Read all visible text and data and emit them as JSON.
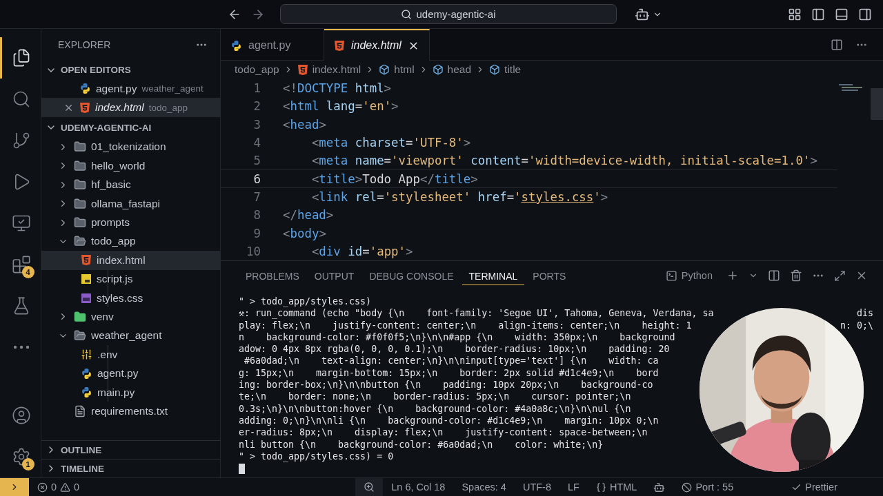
{
  "title_bar": {
    "search": "udemy-agentic-ai"
  },
  "activity_bar": [
    {
      "kind": "explorer",
      "selected": true
    },
    {
      "kind": "search",
      "selected": false
    },
    {
      "kind": "source-control",
      "selected": false
    },
    {
      "kind": "run",
      "selected": false
    },
    {
      "kind": "remote",
      "selected": false
    },
    {
      "kind": "extensions",
      "selected": false,
      "badge": "4"
    },
    {
      "kind": "testing",
      "selected": false
    },
    {
      "kind": "more",
      "selected": false
    }
  ],
  "activity_bottom": [
    {
      "kind": "account"
    },
    {
      "kind": "settings",
      "badge": "1"
    }
  ],
  "sidebar": {
    "title": "EXPLORER",
    "open_editors": {
      "label": "OPEN EDITORS",
      "expanded": true,
      "items": [
        {
          "name": "agent.py",
          "folder": "weather_agent",
          "kind": "python",
          "selected": false
        },
        {
          "name": "index.html",
          "folder": "todo_app",
          "kind": "html",
          "selected": true
        }
      ]
    },
    "workspace": {
      "label": "UDEMY-AGENTIC-AI",
      "expanded": true,
      "items": [
        {
          "name": "01_tokenization",
          "kind": "folder",
          "expanded": false,
          "selected": false
        },
        {
          "name": "hello_world",
          "kind": "folder",
          "expanded": false,
          "selected": false
        },
        {
          "name": "hf_basic",
          "kind": "folder",
          "expanded": false,
          "selected": false
        },
        {
          "name": "ollama_fastapi",
          "kind": "folder",
          "expanded": false,
          "selected": false
        },
        {
          "name": "prompts",
          "kind": "folder",
          "expanded": false,
          "selected": false
        },
        {
          "name": "todo_app",
          "kind": "folder",
          "expanded": true,
          "selected": false,
          "children": [
            {
              "name": "index.html",
              "kind": "html",
              "selected": true
            },
            {
              "name": "script.js",
              "kind": "js",
              "selected": false
            },
            {
              "name": "styles.css",
              "kind": "css",
              "selected": false
            }
          ]
        },
        {
          "name": "venv",
          "kind": "venv",
          "expanded": false,
          "selected": false
        },
        {
          "name": "weather_agent",
          "kind": "folder",
          "expanded": true,
          "selected": false,
          "children": [
            {
              "name": ".env",
              "kind": "env",
              "selected": false
            },
            {
              "name": "agent.py",
              "kind": "python",
              "selected": false
            },
            {
              "name": "main.py",
              "kind": "python",
              "selected": false
            }
          ]
        },
        {
          "name": "requirements.txt",
          "kind": "text",
          "selected": false
        }
      ]
    },
    "sections": [
      {
        "label": "OUTLINE",
        "expanded": false
      },
      {
        "label": "TIMELINE",
        "expanded": false
      }
    ]
  },
  "tabs": [
    {
      "name": "agent.py",
      "kind": "python",
      "selected": false
    },
    {
      "name": "index.html",
      "kind": "html",
      "selected": true
    }
  ],
  "breadcrumb": [
    {
      "label": "todo_app",
      "kind": "folder"
    },
    {
      "label": "index.html",
      "kind": "html"
    },
    {
      "label": "html",
      "kind": "element"
    },
    {
      "label": "head",
      "kind": "element"
    },
    {
      "label": "title",
      "kind": "element"
    }
  ],
  "code": [
    {
      "number": "1",
      "current": false,
      "tokens": [
        {
          "kind": "punct",
          "text": "<!"
        },
        {
          "kind": "tag",
          "text": "DOCTYPE"
        },
        {
          "kind": "attr",
          "text": " html"
        },
        {
          "kind": "punct",
          "text": ">"
        }
      ]
    },
    {
      "number": "2",
      "current": false,
      "tokens": [
        {
          "kind": "punct",
          "text": "<"
        },
        {
          "kind": "tag",
          "text": "html"
        },
        {
          "kind": "attr",
          "text": " lang"
        },
        {
          "kind": "plain",
          "text": "="
        },
        {
          "kind": "str",
          "text": "'en'"
        },
        {
          "kind": "punct",
          "text": ">"
        }
      ]
    },
    {
      "number": "3",
      "current": false,
      "tokens": [
        {
          "kind": "punct",
          "text": "<"
        },
        {
          "kind": "tag",
          "text": "head"
        },
        {
          "kind": "punct",
          "text": ">"
        }
      ]
    },
    {
      "number": "4",
      "current": false,
      "tokens": [
        {
          "kind": "punct",
          "text": "    <"
        },
        {
          "kind": "tag",
          "text": "meta"
        },
        {
          "kind": "attr",
          "text": " charset"
        },
        {
          "kind": "plain",
          "text": "="
        },
        {
          "kind": "str",
          "text": "'UTF-8'"
        },
        {
          "kind": "punct",
          "text": ">"
        }
      ]
    },
    {
      "number": "5",
      "current": false,
      "tokens": [
        {
          "kind": "punct",
          "text": "    <"
        },
        {
          "kind": "tag",
          "text": "meta"
        },
        {
          "kind": "attr",
          "text": " name"
        },
        {
          "kind": "plain",
          "text": "="
        },
        {
          "kind": "str",
          "text": "'viewport'"
        },
        {
          "kind": "attr",
          "text": " content"
        },
        {
          "kind": "plain",
          "text": "="
        },
        {
          "kind": "str",
          "text": "'width=device-width, initial-scale=1.0'"
        },
        {
          "kind": "punct",
          "text": ">"
        }
      ]
    },
    {
      "number": "6",
      "current": true,
      "tokens": [
        {
          "kind": "punct",
          "text": "    <"
        },
        {
          "kind": "tag",
          "text": "title"
        },
        {
          "kind": "punct",
          "text": ">"
        },
        {
          "kind": "plain",
          "text": "Todo App"
        },
        {
          "kind": "punct",
          "text": "</"
        },
        {
          "kind": "tag",
          "text": "title"
        },
        {
          "kind": "punct",
          "text": ">"
        }
      ]
    },
    {
      "number": "7",
      "current": false,
      "tokens": [
        {
          "kind": "punct",
          "text": "    <"
        },
        {
          "kind": "tag",
          "text": "link"
        },
        {
          "kind": "attr",
          "text": " rel"
        },
        {
          "kind": "plain",
          "text": "="
        },
        {
          "kind": "str",
          "text": "'stylesheet'"
        },
        {
          "kind": "attr",
          "text": " href"
        },
        {
          "kind": "plain",
          "text": "="
        },
        {
          "kind": "str",
          "text": "'"
        },
        {
          "kind": "link",
          "text": "styles.css"
        },
        {
          "kind": "str",
          "text": "'"
        },
        {
          "kind": "punct",
          "text": ">"
        }
      ]
    },
    {
      "number": "8",
      "current": false,
      "tokens": [
        {
          "kind": "punct",
          "text": "</"
        },
        {
          "kind": "tag",
          "text": "head"
        },
        {
          "kind": "punct",
          "text": ">"
        }
      ]
    },
    {
      "number": "9",
      "current": false,
      "tokens": [
        {
          "kind": "punct",
          "text": "<"
        },
        {
          "kind": "tag",
          "text": "body"
        },
        {
          "kind": "punct",
          "text": ">"
        }
      ]
    },
    {
      "number": "10",
      "current": false,
      "tokens": [
        {
          "kind": "punct",
          "text": "    <"
        },
        {
          "kind": "tag",
          "text": "div"
        },
        {
          "kind": "attr",
          "text": " id"
        },
        {
          "kind": "plain",
          "text": "="
        },
        {
          "kind": "str",
          "text": "'app'"
        },
        {
          "kind": "punct",
          "text": ">"
        }
      ]
    }
  ],
  "panel": {
    "tabs": [
      {
        "label": "PROBLEMS",
        "selected": false
      },
      {
        "label": "OUTPUT",
        "selected": false
      },
      {
        "label": "DEBUG CONSOLE",
        "selected": false
      },
      {
        "label": "TERMINAL",
        "selected": true
      },
      {
        "label": "PORTS",
        "selected": false
      }
    ],
    "shell": "Python",
    "lines": [
      {
        "text": "\" > todo_app/styles.css)"
      },
      {
        "text": "⚒: run_command (echo \"body {\\n    font-family: 'Segoe UI', Tahoma, Geneva, Verdana, sa",
        "tail": "dis"
      },
      {
        "text": "play: flex;\\n    justify-content: center;\\n    align-items: center;\\n    height: 1",
        "tail": "n: 0;\\"
      },
      {
        "text": "n    background-color: #f0f0f5;\\n}\\n\\n#app {\\n    width: 350px;\\n    background"
      },
      {
        "text": "adow: 0 4px 8px rgba(0, 0, 0, 0.1);\\n    border-radius: 10px;\\n    padding: 20"
      },
      {
        "text": " #6a0dad;\\n    text-align: center;\\n}\\n\\ninput[type='text'] {\\n    width: ca"
      },
      {
        "text": "g: 15px;\\n    margin-bottom: 15px;\\n    border: 2px solid #d1c4e9;\\n    bord"
      },
      {
        "text": "ing: border-box;\\n}\\n\\nbutton {\\n    padding: 10px 20px;\\n    background-co"
      },
      {
        "text": "te;\\n    border: none;\\n    border-radius: 5px;\\n    cursor: pointer;\\n"
      },
      {
        "text": "0.3s;\\n}\\n\\nbutton:hover {\\n    background-color: #4a0a8c;\\n}\\n\\nul {\\n"
      },
      {
        "text": "adding: 0;\\n}\\n\\nli {\\n    background-color: #d1c4e9;\\n    margin: 10px 0;\\n"
      },
      {
        "text": "er-radius: 8px;\\n    display: flex;\\n    justify-content: space-between;\\n"
      },
      {
        "text": "nli button {\\n    background-color: #6a0dad;\\n    color: white;\\n}"
      },
      {
        "text": "\" > todo_app/styles.css) = 0"
      }
    ]
  },
  "status_bar": {
    "errors": "0",
    "warnings": "0",
    "items": [
      {
        "kind": "zoom"
      },
      {
        "kind": "text",
        "label": "Ln 6, Col 18"
      },
      {
        "kind": "text",
        "label": "Spaces: 4"
      },
      {
        "kind": "text",
        "label": "UTF-8"
      },
      {
        "kind": "text",
        "label": "LF"
      },
      {
        "kind": "language",
        "label": "HTML"
      },
      {
        "kind": "copilot"
      },
      {
        "kind": "port",
        "label": "Port : 55"
      },
      {
        "kind": "prettier",
        "label": "Prettier"
      }
    ]
  }
}
